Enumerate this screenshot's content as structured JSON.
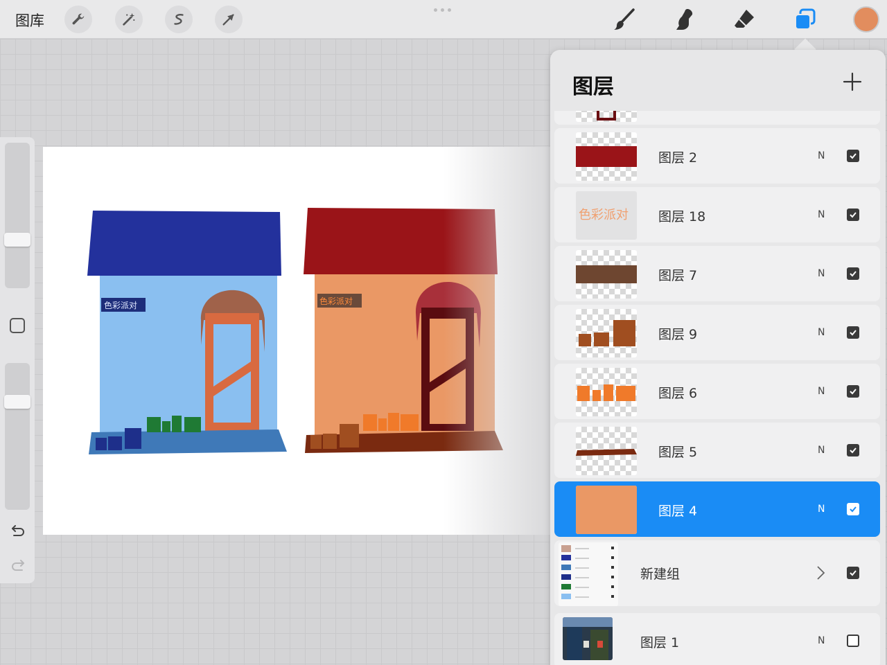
{
  "toolbar": {
    "gallery_label": "图库",
    "tools": [
      {
        "name": "actions",
        "icon": "wrench-icon"
      },
      {
        "name": "adjustments",
        "icon": "magic-wand-icon"
      },
      {
        "name": "selection",
        "icon": "selection-s-icon"
      },
      {
        "name": "transform",
        "icon": "arrow-cursor-icon"
      }
    ],
    "right_tools": [
      {
        "name": "brush",
        "icon": "brush-icon"
      },
      {
        "name": "smudge",
        "icon": "smudge-icon"
      },
      {
        "name": "eraser",
        "icon": "eraser-icon"
      },
      {
        "name": "layers",
        "icon": "layers-icon",
        "active_color": "#1a8cf5"
      }
    ],
    "current_color": "#e28d5e"
  },
  "layers_panel": {
    "title": "图层",
    "add_icon": "plus-icon",
    "layers": [
      {
        "name": "",
        "blend": "",
        "visible": true,
        "thumb": "partial"
      },
      {
        "name": "图层 2",
        "blend": "N",
        "visible": true,
        "thumb": "red-roof"
      },
      {
        "name": "图层 18",
        "blend": "N",
        "visible": true,
        "thumb": "sign-text"
      },
      {
        "name": "图层 7",
        "blend": "N",
        "visible": true,
        "thumb": "brown-bar"
      },
      {
        "name": "图层 9",
        "blend": "N",
        "visible": true,
        "thumb": "brown-pots"
      },
      {
        "name": "图层 6",
        "blend": "N",
        "visible": true,
        "thumb": "orange-pots"
      },
      {
        "name": "图层 5",
        "blend": "N",
        "visible": true,
        "thumb": "ledge"
      },
      {
        "name": "图层 4",
        "blend": "N",
        "visible": true,
        "thumb": "orange-fill",
        "selected": true
      },
      {
        "name": "新建组",
        "blend": "",
        "visible": true,
        "thumb": "group",
        "is_group": true
      },
      {
        "name": "图层 1",
        "blend": "N",
        "visible": false,
        "thumb": "photo"
      }
    ],
    "thumb_sign_text": "色彩派对"
  },
  "canvas": {
    "sign_text_blue": "色彩派对",
    "sign_text_orange": "色彩派对"
  },
  "colors": {
    "accent": "#1a8cf5",
    "panel_bg": "#e7e7e8"
  }
}
